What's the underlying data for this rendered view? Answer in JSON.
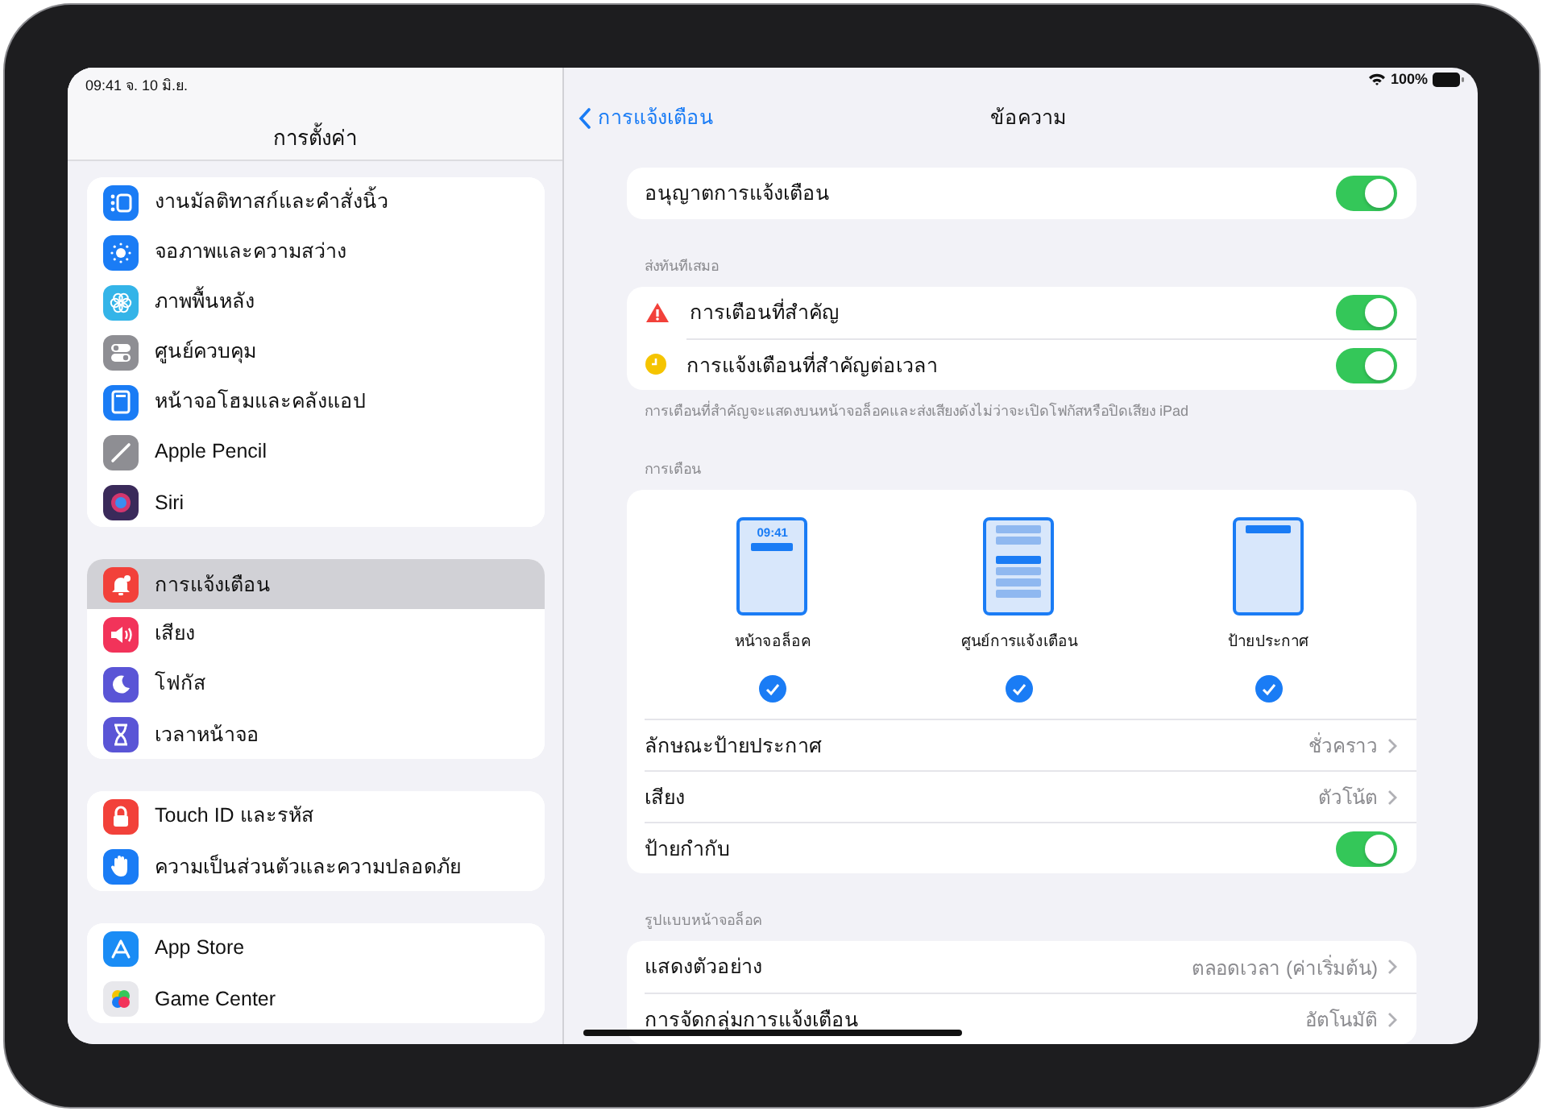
{
  "status_bar": {
    "time": "09:41",
    "date": "จ. 10 มิ.ย.",
    "battery": "100%"
  },
  "sidebar": {
    "title": "การตั้งค่า",
    "groups": [
      {
        "items": [
          {
            "label": "งานมัลติทาสก์และคำสั่งนิ้ว",
            "color": "#1a7cf5",
            "selected": false
          },
          {
            "label": "จอภาพและความสว่าง",
            "color": "#1a7cf5",
            "selected": false
          },
          {
            "label": "ภาพพื้นหลัง",
            "color": "#34b4e8",
            "selected": false
          },
          {
            "label": "ศูนย์ควบคุม",
            "color": "#8e8e93",
            "selected": false
          },
          {
            "label": "หน้าจอโฮมและคลังแอป",
            "color": "#1a7cf5",
            "selected": false
          },
          {
            "label": "Apple Pencil",
            "color": "#8e8e93",
            "selected": false
          },
          {
            "label": "Siri",
            "color": "#3a2a5a",
            "selected": false
          }
        ]
      },
      {
        "items": [
          {
            "label": "การแจ้งเตือน",
            "color": "#f2413a",
            "selected": true
          },
          {
            "label": "เสียง",
            "color": "#f2335a",
            "selected": false
          },
          {
            "label": "โฟกัส",
            "color": "#5a55d6",
            "selected": false
          },
          {
            "label": "เวลาหน้าจอ",
            "color": "#5a55d6",
            "selected": false
          }
        ]
      },
      {
        "items": [
          {
            "label": "Touch ID และรหัส",
            "color": "#f2413a",
            "selected": false
          },
          {
            "label": "ความเป็นส่วนตัวและความปลอดภัย",
            "color": "#1a7cf5",
            "selected": false
          }
        ]
      },
      {
        "items": [
          {
            "label": "App Store",
            "color": "#1a8cf5",
            "selected": false
          },
          {
            "label": "Game Center",
            "color": "#e8e8ec",
            "selected": false
          }
        ]
      }
    ]
  },
  "detail": {
    "back_label": "การแจ้งเตือน",
    "title": "ข้อความ",
    "sections": [
      {
        "rows": [
          {
            "kind": "toggle",
            "label": "อนุญาตการแจ้งเตือน",
            "on": true
          }
        ]
      },
      {
        "header": "ส่งทันทีเสมอ",
        "rows": [
          {
            "kind": "toggle",
            "label": "การเตือนที่สำคัญ",
            "on": true,
            "color": "#f2413a"
          },
          {
            "kind": "toggle",
            "label": "การแจ้งเตือนที่สำคัญต่อเวลา",
            "on": true,
            "color": "#f5c400"
          }
        ],
        "footer": "การเตือนที่สำคัญจะแสดงบนหน้าจอล็อคและส่งเสียงดังไม่ว่าจะเปิดโฟกัสหรือปิดเสียง iPad"
      },
      {
        "header": "การเตือน",
        "styles": [
          {
            "label": "หน้าจอล็อค",
            "time": "09:41",
            "selected": true
          },
          {
            "label": "ศูนย์การแจ้งเตือน",
            "selected": true
          },
          {
            "label": "ป้ายประกาศ",
            "selected": true
          }
        ],
        "rows": [
          {
            "kind": "value",
            "label": "ลักษณะป้ายประกาศ",
            "value": "ชั่วคราว"
          },
          {
            "kind": "value",
            "label": "เสียง",
            "value": "ตัวโน้ต"
          },
          {
            "kind": "toggle",
            "label": "ป้ายกำกับ",
            "on": true
          }
        ]
      },
      {
        "header": "รูปแบบหน้าจอล็อค",
        "rows": [
          {
            "kind": "value",
            "label": "แสดงตัวอย่าง",
            "value": "ตลอดเวลา (ค่าเริ่มต้น)"
          },
          {
            "kind": "value",
            "label": "การจัดกลุ่มการแจ้งเตือน",
            "value": "อัตโนมัติ"
          }
        ]
      }
    ]
  }
}
